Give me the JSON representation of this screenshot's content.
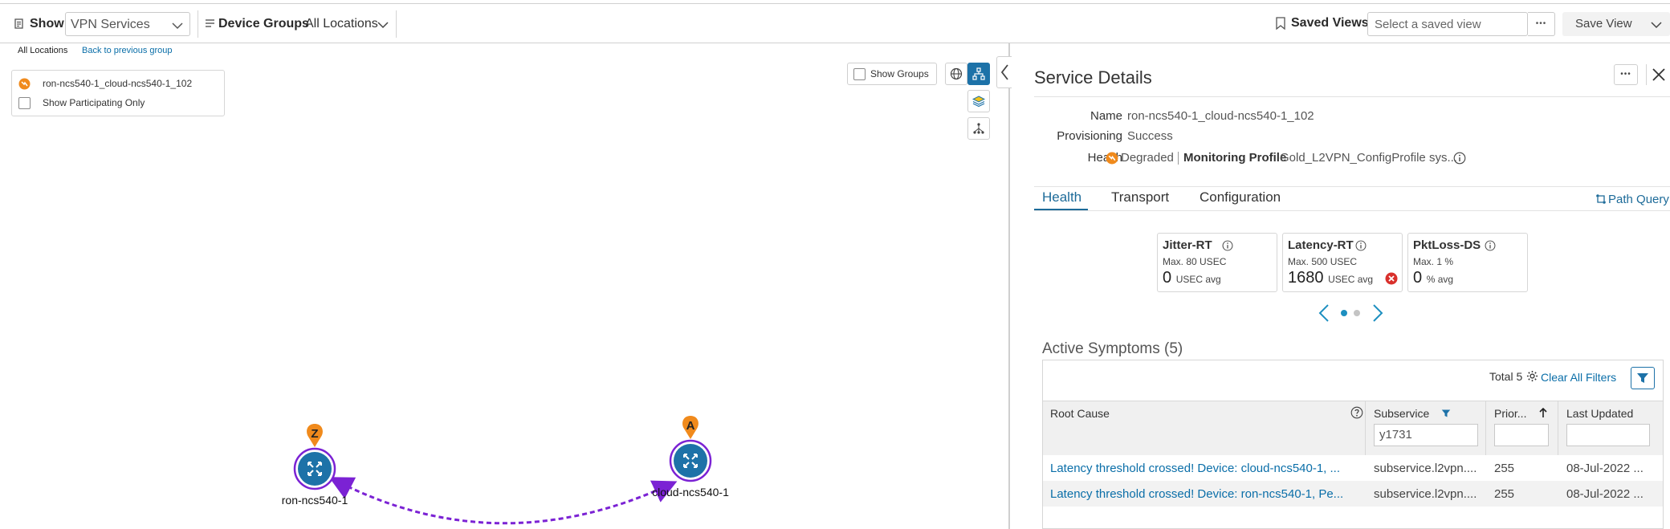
{
  "toolbar": {
    "show_label": "Show",
    "show_value": "VPN Services",
    "device_groups_label": "Device Groups",
    "device_groups_value": "All Locations",
    "saved_views_label": "Saved Views",
    "saved_view_placeholder": "Select a saved view",
    "more_label": "•••",
    "save_view_label": "Save View"
  },
  "map": {
    "breadcrumb_all": "All Locations",
    "back_link": "Back to previous group",
    "selected_service": "ron-ncs540-1_cloud-ncs540-1_102",
    "show_participating_label": "Show Participating Only",
    "show_groups_label": "Show Groups",
    "nodes": [
      {
        "label": "ron-ncs540-1",
        "marker": "Z"
      },
      {
        "label": "cloud-ncs540-1",
        "marker": "A"
      }
    ]
  },
  "panel": {
    "title": "Service Details",
    "more_label": "•••",
    "fields": {
      "name_label": "Name",
      "name_value": "ron-ncs540-1_cloud-ncs540-1_102",
      "provisioning_label": "Provisioning",
      "provisioning_value": "Success",
      "health_label": "Health",
      "health_value": "Degraded",
      "monitoring_label": "Monitoring Profile",
      "monitoring_value": "Gold_L2VPN_ConfigProfile sys..."
    },
    "tabs": [
      "Health",
      "Transport",
      "Configuration"
    ],
    "active_tab": "Health",
    "path_query_label": "Path Query",
    "kpis": [
      {
        "title": "Jitter-RT",
        "max": "Max. 80 USEC",
        "value": "0",
        "unit": "USEC avg",
        "error": false
      },
      {
        "title": "Latency-RT",
        "max": "Max. 500 USEC",
        "value": "1680",
        "unit": "USEC avg",
        "error": true
      },
      {
        "title": "PktLoss-DS",
        "max": "Max. 1 %",
        "value": "0",
        "unit": "% avg",
        "error": false
      }
    ],
    "symptoms": {
      "heading": "Active Symptoms (5)",
      "total_label": "Total 5",
      "clear_filters_label": "Clear All Filters",
      "columns": [
        "Root Cause",
        "Subservice",
        "Prior...",
        "Last Updated"
      ],
      "subservice_filter": "y1731",
      "rows": [
        {
          "root_cause": "Latency threshold crossed! Device: cloud-ncs540-1, ...",
          "subservice": "subservice.l2vpn....",
          "priority": "255",
          "updated": "08-Jul-2022 ..."
        },
        {
          "root_cause": "Latency threshold crossed! Device: ron-ncs540-1, Pe...",
          "subservice": "subservice.l2vpn....",
          "priority": "255",
          "updated": "08-Jul-2022 ..."
        }
      ]
    }
  },
  "colors": {
    "accent": "#1d72a8",
    "degraded": "#f08a1c",
    "error": "#d9302c",
    "link_path": "#7b22d4"
  }
}
